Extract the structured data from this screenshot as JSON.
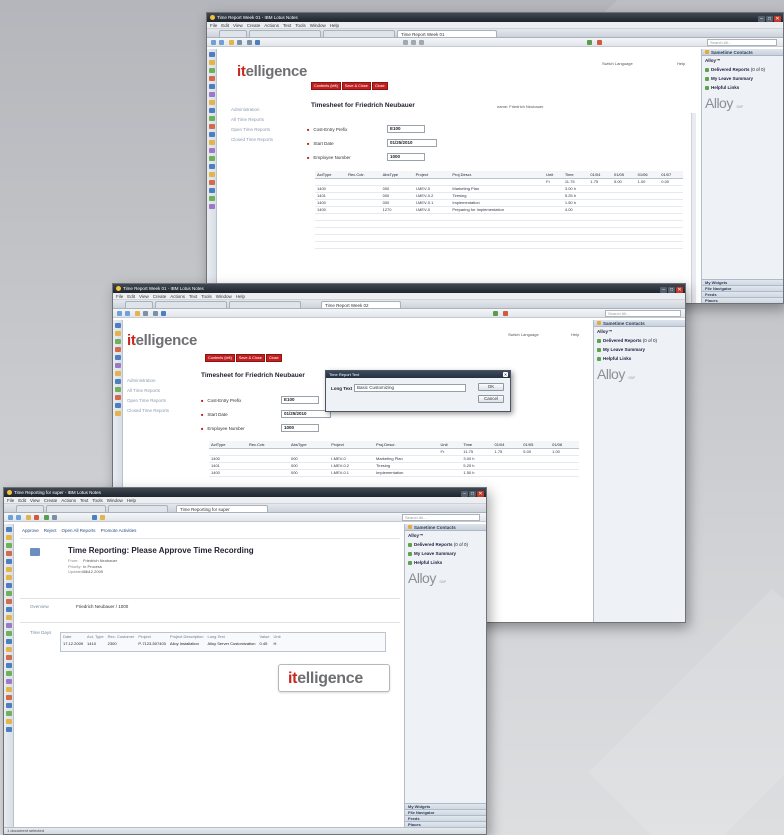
{
  "colors": {
    "brand_red": "#c0201f",
    "titlebar": "#1f252d",
    "link_blue": "#2a4f80"
  },
  "app_menu": [
    "File",
    "Edit",
    "View",
    "Create",
    "Actions",
    "Text",
    "Tools",
    "Window",
    "Help"
  ],
  "sidebar": {
    "header": "Sametime Contacts",
    "alloy_item": "Alloy™",
    "items": [
      "Delivered Reports",
      "My Leave Summary",
      "Helpful Links"
    ],
    "delivered_count": "(0 of 0)",
    "logo_text": "Alloy",
    "logo_small": "SAP",
    "footer": [
      "My Widgets",
      "File Navigator",
      "Feeds",
      "Places"
    ]
  },
  "logo": {
    "left_part": "it",
    "right_part": "elligence"
  },
  "buttons": [
    "Contents (left)",
    "Save & Close",
    "Close"
  ],
  "nav": [
    "Administration",
    "All Time Reports",
    "Open Time Reports",
    "Closed Time Reports"
  ],
  "header_links": [
    "Switch Language",
    "Help"
  ],
  "timesheet": {
    "title": "Timesheet for Friedrich Neubauer",
    "author_label": "name:",
    "author": "Friedrich Neubauer",
    "fields": [
      {
        "label": "Cost-Entry Prefix",
        "value": "E100"
      },
      {
        "label": "Start Date",
        "value": "01/25/2010"
      },
      {
        "label": "Employee Number",
        "value": "1000"
      }
    ],
    "columns": [
      "ActType",
      "Rec.Cctr.",
      "AbsType",
      "Project",
      "Proj.Descr.",
      "Unit",
      "Time",
      "01/04",
      "01/05",
      "01/06",
      "01/07",
      "01/08",
      "01/09",
      "01/10"
    ],
    "rows": [
      {
        "act": "1400",
        "absorb": "000",
        "project": "I-MEV-0",
        "descr": "Marketing Plan",
        "time": "3.00 h"
      },
      {
        "act": "1401",
        "absorb": "000",
        "project": "I-MEV-0.2",
        "descr": "Tiresing",
        "time": "5.25 h"
      },
      {
        "act": "1400",
        "absorb": "000",
        "project": "I-MEV-0.1",
        "descr": "Implementation",
        "time": "1.50 h"
      },
      {
        "act": "1400",
        "absorb": "1270",
        "project": "I-MEV-0",
        "descr": "Preparing for Implementation",
        "time": "4.00"
      }
    ],
    "totals_row": [
      "Fr",
      "11.75",
      "1.75",
      "5.00",
      "1.00",
      "0.00",
      "0.00",
      "0.00",
      "2.00"
    ]
  },
  "window1": {
    "title": "Time Report Week 01 - IBM Lotus Notes",
    "tab": "Time Report Week 01"
  },
  "window2": {
    "title": "Time Report Week 01 - IBM Lotus Notes",
    "tab": "Time Report Week 02",
    "dialog": {
      "title": "Time Report Text",
      "label": "Long Text",
      "value": "Basic Customizing",
      "ok": "OK",
      "cancel": "Cancel"
    }
  },
  "window3": {
    "title": "Time Reporting for super - IBM Lotus Notes",
    "tab": "Time Reporting for super",
    "actions": [
      "Approve",
      "Reject",
      "Open All Reports",
      "Promote Activities"
    ],
    "request_title": "Time Reporting: Please Approve Time Recording",
    "meta": [
      {
        "k": "From:",
        "v": "Friedrich Neubauer"
      },
      {
        "k": "Priority:",
        "v": "In Process"
      },
      {
        "k": "Updated on:",
        "v": "03.12.2009"
      }
    ],
    "who_label": "Overview",
    "who_value": "Friedrich Neubauer / 1000",
    "grid_label": "Time Days",
    "grid_columns": [
      "Date",
      "Act. Type",
      "Rec. Customer",
      "Project",
      "Project Description",
      "Long Text",
      "Value",
      "Unit"
    ],
    "grid_row": [
      "17.12.2009",
      "1410",
      "2300",
      "P-7123-507403",
      "Alloy Installation",
      "Alloy Server Customization",
      "0.45",
      "H"
    ],
    "status": "1 document selected"
  }
}
